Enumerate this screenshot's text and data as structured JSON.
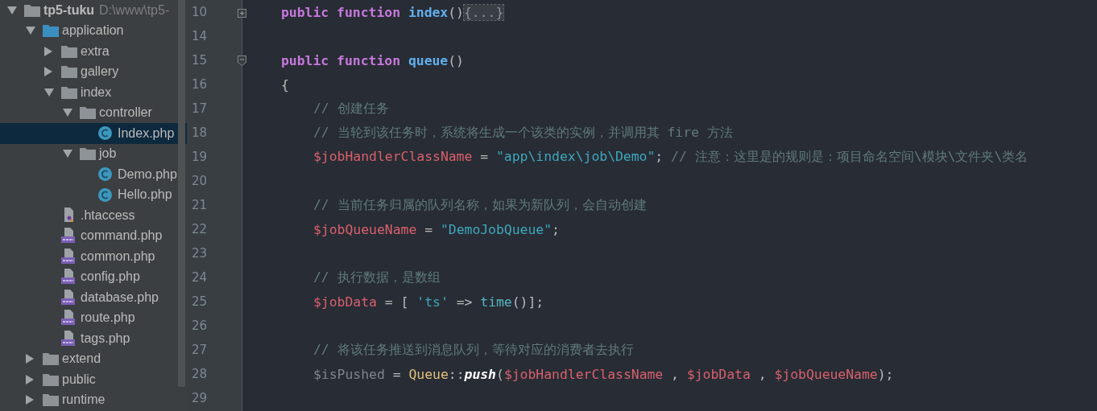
{
  "project_tree": {
    "root": {
      "label": "tp5-tuku",
      "path": "D:\\www\\tp5-",
      "kind": "folder",
      "expanded": true,
      "selected": false,
      "children": [
        {
          "label": "application",
          "kind": "source-folder",
          "expanded": true,
          "selected": false,
          "children": [
            {
              "label": "extra",
              "kind": "folder",
              "expanded": false,
              "selected": false
            },
            {
              "label": "gallery",
              "kind": "folder",
              "expanded": false,
              "selected": false
            },
            {
              "label": "index",
              "kind": "folder",
              "expanded": true,
              "selected": false,
              "children": [
                {
                  "label": "controller",
                  "kind": "folder",
                  "expanded": true,
                  "selected": false,
                  "children": [
                    {
                      "label": "Index.php",
                      "kind": "php-class",
                      "selected": true
                    }
                  ]
                },
                {
                  "label": "job",
                  "kind": "folder",
                  "expanded": true,
                  "selected": false,
                  "children": [
                    {
                      "label": "Demo.php",
                      "kind": "php-class",
                      "selected": false
                    },
                    {
                      "label": "Hello.php",
                      "kind": "php-class",
                      "selected": false
                    }
                  ]
                }
              ]
            },
            {
              "label": ".htaccess",
              "kind": "htaccess",
              "selected": false
            },
            {
              "label": "command.php",
              "kind": "php",
              "selected": false
            },
            {
              "label": "common.php",
              "kind": "php",
              "selected": false
            },
            {
              "label": "config.php",
              "kind": "php",
              "selected": false
            },
            {
              "label": "database.php",
              "kind": "php",
              "selected": false
            },
            {
              "label": "route.php",
              "kind": "php",
              "selected": false
            },
            {
              "label": "tags.php",
              "kind": "php",
              "selected": false
            }
          ]
        },
        {
          "label": "extend",
          "kind": "folder",
          "expanded": false,
          "selected": false
        },
        {
          "label": "public",
          "kind": "folder",
          "expanded": false,
          "selected": false
        },
        {
          "label": "runtime",
          "kind": "folder",
          "expanded": false,
          "selected": false
        }
      ]
    }
  },
  "editor": {
    "lines": [
      {
        "number": "10",
        "kind": "member",
        "collapsed": true,
        "tokens": [
          {
            "kind": "keyword",
            "text": "public function "
          },
          {
            "kind": "function",
            "text": "index"
          },
          {
            "kind": "plain",
            "text": "()"
          },
          {
            "kind": "folded",
            "text": "{...}"
          }
        ]
      },
      {
        "number": "14"
      },
      {
        "number": "15",
        "kind": "member",
        "collapsed": false,
        "tokens": [
          {
            "kind": "keyword",
            "text": "public function "
          },
          {
            "kind": "function",
            "text": "queue"
          },
          {
            "kind": "plain",
            "text": "()"
          }
        ]
      },
      {
        "number": "16",
        "kind": "member",
        "tokens": [
          {
            "kind": "plain",
            "text": "{"
          }
        ]
      },
      {
        "number": "17",
        "kind": "body",
        "tokens": [
          {
            "kind": "comment",
            "text": "// 创建任务"
          }
        ]
      },
      {
        "number": "18",
        "kind": "body",
        "tokens": [
          {
            "kind": "comment",
            "text": "// 当轮到该任务时，系统将生成一个该类的实例，并调用其 fire 方法"
          }
        ]
      },
      {
        "number": "19",
        "kind": "body",
        "tokens": [
          {
            "kind": "variable",
            "text": "$jobHandlerClassName"
          },
          {
            "kind": "plain",
            "text": " = "
          },
          {
            "kind": "string",
            "text": "\"app\\index\\job\\Demo\""
          },
          {
            "kind": "plain",
            "text": "; "
          },
          {
            "kind": "comment",
            "text": "// 注意：这里是的规则是：项目命名空间\\模块\\文件夹\\类名"
          }
        ]
      },
      {
        "number": "20"
      },
      {
        "number": "21",
        "kind": "body",
        "tokens": [
          {
            "kind": "comment",
            "text": "// 当前任务归属的队列名称，如果为新队列，会自动创建"
          }
        ]
      },
      {
        "number": "22",
        "kind": "body",
        "tokens": [
          {
            "kind": "variable",
            "text": "$jobQueueName"
          },
          {
            "kind": "plain",
            "text": " = "
          },
          {
            "kind": "string",
            "text": "\"DemoJobQueue\""
          },
          {
            "kind": "plain",
            "text": ";"
          }
        ]
      },
      {
        "number": "23"
      },
      {
        "number": "24",
        "kind": "body",
        "tokens": [
          {
            "kind": "comment",
            "text": "// 执行数据，是数组"
          }
        ]
      },
      {
        "number": "25",
        "kind": "body",
        "tokens": [
          {
            "kind": "variable",
            "text": "$jobData"
          },
          {
            "kind": "plain",
            "text": " = [ "
          },
          {
            "kind": "string",
            "text": "'ts'"
          },
          {
            "kind": "plain",
            "text": " => "
          },
          {
            "kind": "call",
            "text": "time"
          },
          {
            "kind": "plain",
            "text": "()];"
          }
        ]
      },
      {
        "number": "26"
      },
      {
        "number": "27",
        "kind": "body",
        "tokens": [
          {
            "kind": "comment",
            "text": "// 将该任务推送到消息队列，等待对应的消费者去执行"
          }
        ]
      },
      {
        "number": "28",
        "kind": "body",
        "tokens": [
          {
            "kind": "unused",
            "text": "$isPushed"
          },
          {
            "kind": "plain",
            "text": " = "
          },
          {
            "kind": "class",
            "text": "Queue"
          },
          {
            "kind": "plain",
            "text": "::"
          },
          {
            "kind": "static-call",
            "text": "push"
          },
          {
            "kind": "plain",
            "text": "("
          },
          {
            "kind": "variable",
            "text": "$jobHandlerClassName"
          },
          {
            "kind": "plain",
            "text": " , "
          },
          {
            "kind": "variable",
            "text": "$jobData"
          },
          {
            "kind": "plain",
            "text": " , "
          },
          {
            "kind": "variable",
            "text": "$jobQueueName"
          },
          {
            "kind": "plain",
            "text": ");"
          }
        ]
      },
      {
        "number": "29"
      }
    ]
  }
}
